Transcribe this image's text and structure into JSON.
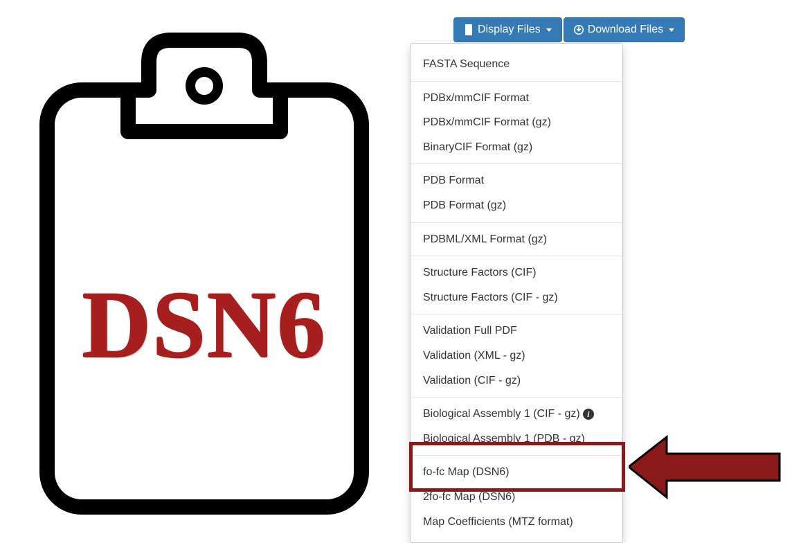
{
  "clipboard": {
    "label": "DSN6"
  },
  "buttons": {
    "display": "Display Files",
    "download": "Download Files"
  },
  "menu": {
    "groups": [
      {
        "items": [
          {
            "label": "FASTA Sequence"
          }
        ]
      },
      {
        "items": [
          {
            "label": "PDBx/mmCIF Format"
          },
          {
            "label": "PDBx/mmCIF Format (gz)"
          },
          {
            "label": "BinaryCIF Format (gz)"
          }
        ]
      },
      {
        "items": [
          {
            "label": "PDB Format"
          },
          {
            "label": "PDB Format (gz)"
          }
        ]
      },
      {
        "items": [
          {
            "label": "PDBML/XML Format (gz)"
          }
        ]
      },
      {
        "items": [
          {
            "label": "Structure Factors (CIF)"
          },
          {
            "label": "Structure Factors (CIF - gz)"
          }
        ]
      },
      {
        "items": [
          {
            "label": "Validation Full PDF"
          },
          {
            "label": "Validation (XML - gz)"
          },
          {
            "label": "Validation (CIF - gz)"
          }
        ]
      },
      {
        "items": [
          {
            "label": "Biological Assembly 1 (CIF - gz)",
            "info": true
          },
          {
            "label": "Biological Assembly 1 (PDB - gz)"
          }
        ]
      },
      {
        "items": [
          {
            "label": "fo-fc Map (DSN6)"
          },
          {
            "label": "2fo-fc Map (DSN6)"
          },
          {
            "label": "Map Coefficients (MTZ format)"
          }
        ]
      }
    ]
  },
  "colors": {
    "accent": "#337ab7",
    "highlight": "#8a1a1a",
    "dsn6": "#a71e1e"
  }
}
